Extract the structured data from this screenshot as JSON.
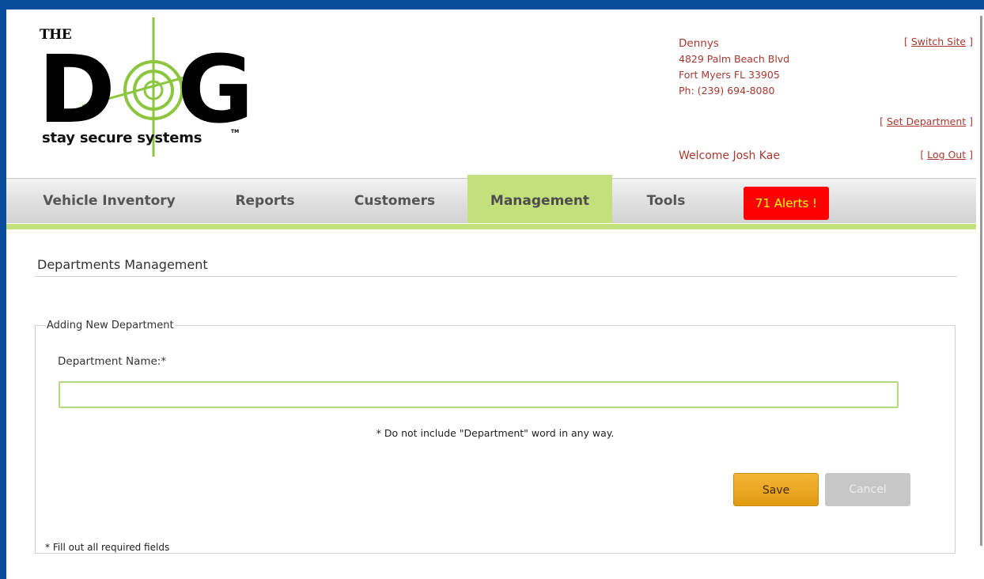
{
  "logo": {
    "the_text": "THE",
    "letters_d": "D",
    "letters_g": "G",
    "tagline": "stay secure systems",
    "tm": "TM"
  },
  "site": {
    "name": "Dennys",
    "address1": "4829 Palm Beach Blvd",
    "address2": "Fort Myers FL 33905",
    "phone": "Ph: (239) 694-8080"
  },
  "user": {
    "welcome": "Welcome Josh Kae"
  },
  "links": {
    "switch_site": "Switch Site",
    "set_department": "Set Department",
    "log_out": "Log Out",
    "bracket_open": "[ ",
    "bracket_close": " ]"
  },
  "nav": {
    "tabs": [
      {
        "label": "Vehicle Inventory",
        "active": false
      },
      {
        "label": "Reports",
        "active": false
      },
      {
        "label": "Customers",
        "active": false
      },
      {
        "label": "Management",
        "active": true
      },
      {
        "label": "Tools",
        "active": false
      }
    ],
    "alerts": "71 Alerts !"
  },
  "page": {
    "title": "Departments Management",
    "section_legend": "Adding New Department",
    "field_label": "Department Name:*",
    "field_value": "",
    "hint": "* Do not include \"Department\" word in any way.",
    "save": "Save",
    "cancel": "Cancel",
    "required_note": "* Fill out all required fields"
  },
  "colors": {
    "frame_blue": "#0a4c9c",
    "accent_green": "#c3e07d",
    "site_red": "#a8392f",
    "alert_red": "#ff0000",
    "alert_text": "#ffff00",
    "save_orange": "#e8a21c"
  }
}
